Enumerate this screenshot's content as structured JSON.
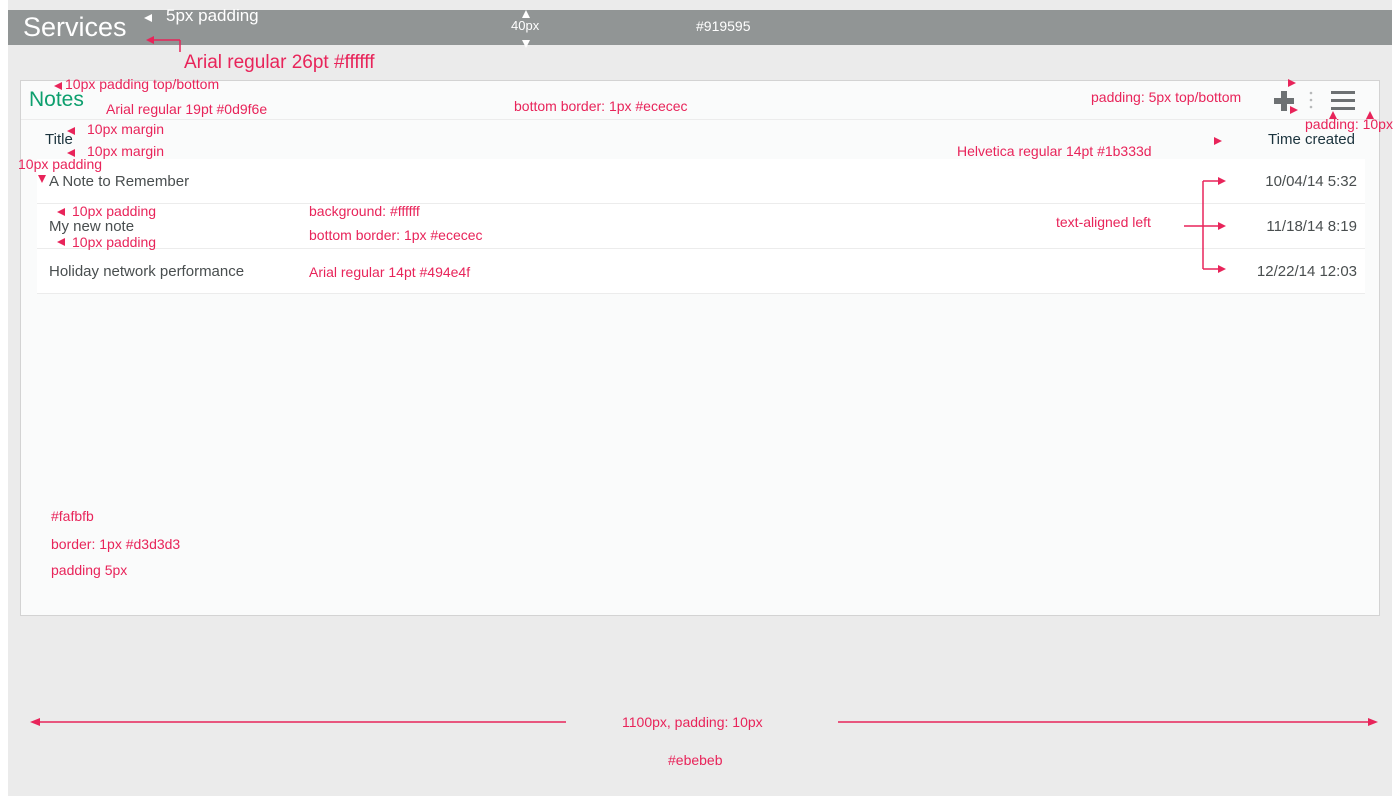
{
  "app": {
    "title": "Services"
  },
  "notes_panel": {
    "title": "Notes",
    "columns": {
      "title": "Title",
      "time": "Time created"
    },
    "rows": [
      {
        "title": "A Note to Remember",
        "time": "10/04/14 5:32"
      },
      {
        "title": "My new note",
        "time": "11/18/14 8:19"
      },
      {
        "title": "Holiday network performance",
        "time": "12/22/14 12:03"
      }
    ],
    "icons": [
      "plus-icon",
      "kebab-icon",
      "menu-icon"
    ]
  },
  "annotations": {
    "pad_5": "5px padding",
    "height_40": "40px",
    "topbar_color": "#919595",
    "title_font": "Arial regular 26pt #ffffff",
    "pad_10_tb": "10px padding top/bottom",
    "notes_font": "Arial regular 19pt #0d9f6e",
    "bottom_border": "bottom border: 1px #ececec",
    "icon_padding_tb": "padding: 5px top/bottom",
    "icon_padding": "padding: 10px",
    "margin_10_a": "10px margin",
    "margin_10_b": "10px margin",
    "header_font": "Helvetica regular 14pt #1b333d",
    "pad_10_left": "10px padding",
    "pad_10_row_a": "10px padding",
    "pad_10_row_b": "10px padding",
    "row_bg": "background: #ffffff",
    "row_border": "bottom border: 1px #ececec",
    "text_aligned": "text-aligned left",
    "row_font": "Arial regular 14pt #494e4f",
    "panel_bg": "#fafbfb",
    "panel_border": "border: 1px #d3d3d3",
    "panel_padding": "padding 5px",
    "page_width": "1100px, padding: 10px",
    "page_bg": "#ebebeb"
  },
  "colors": {
    "topbar": "#919595",
    "accent": "#0d9f6e",
    "annotation": "#e8245a",
    "page": "#ebebeb",
    "panel": "#fafbfb"
  }
}
